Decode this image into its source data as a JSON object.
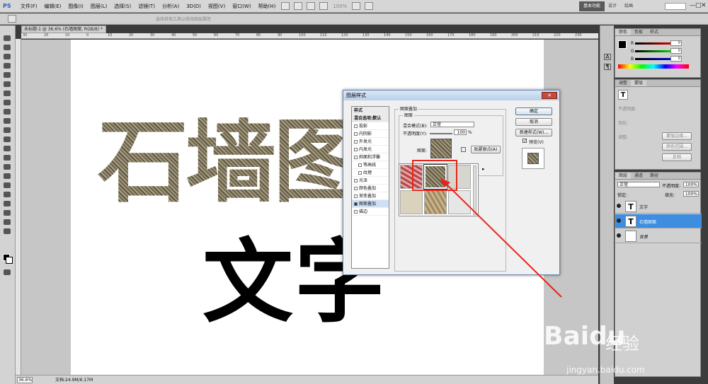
{
  "app": {
    "logo": "PS",
    "menus": [
      "文件(F)",
      "编辑(E)",
      "图像(I)",
      "图层(L)",
      "选择(S)",
      "滤镜(T)",
      "分析(A)",
      "3D(D)",
      "视图(V)",
      "窗口(W)",
      "帮助(H)"
    ],
    "zoom_readout": "100%",
    "workspaces": {
      "active": "基本功能",
      "design": "设计",
      "painting": "绘画"
    },
    "window_controls": [
      "—",
      "□",
      "✕"
    ]
  },
  "options_bar": {
    "hint": "选择其他工具以修改图层属性"
  },
  "document": {
    "tab_title": "未标题-1 @ 36.6% (石墙图案, RGB/8) *",
    "ruler_ticks": [
      "30",
      "20",
      "10",
      "0",
      "10",
      "20",
      "30",
      "40",
      "50",
      "60",
      "70",
      "80",
      "90",
      "100",
      "110",
      "120",
      "130",
      "140",
      "150",
      "160",
      "170",
      "180",
      "190",
      "200",
      "210",
      "220",
      "230"
    ],
    "stone_text": "石墙图",
    "black_text": "文字"
  },
  "status": {
    "zoom": "36.6%",
    "doc_info": "文档:24.9M/6.17M"
  },
  "color_panel": {
    "tabs": [
      "颜色",
      "色板",
      "样式"
    ],
    "channels": [
      {
        "label": "R",
        "value": "0"
      },
      {
        "label": "G",
        "value": "0"
      },
      {
        "label": "B",
        "value": "0"
      }
    ]
  },
  "adjust_panel": {
    "tabs": [
      "调整",
      "蒙版"
    ],
    "items": [
      "不透明度:",
      "羽化:",
      "调整:"
    ],
    "buttons": [
      "蒙版边缘...",
      "颜色范围...",
      "反相"
    ]
  },
  "layers_panel": {
    "tabs": [
      "图层",
      "通道",
      "路径"
    ],
    "blend_mode": "正常",
    "opacity_label": "不透明度:",
    "opacity": "100%",
    "lock_label": "锁定:",
    "fill_label": "填充:",
    "fill": "100%",
    "layers": [
      {
        "name": "文字",
        "thumb": "T",
        "selected": false
      },
      {
        "name": "石墙图案",
        "thumb": "T",
        "selected": true
      },
      {
        "name": "背景",
        "thumb": "",
        "selected": false
      }
    ]
  },
  "dialog": {
    "title": "图层样式",
    "close": "✕",
    "styles": [
      {
        "label": "样式",
        "head": true,
        "checkbox": false,
        "checked": false,
        "indent": false
      },
      {
        "label": "混合选项:默认",
        "head": true,
        "checkbox": false,
        "checked": false,
        "indent": false
      },
      {
        "label": "投影",
        "head": false,
        "checkbox": true,
        "checked": false,
        "indent": false
      },
      {
        "label": "内阴影",
        "head": false,
        "checkbox": true,
        "checked": false,
        "indent": false
      },
      {
        "label": "外发光",
        "head": false,
        "checkbox": true,
        "checked": false,
        "indent": false
      },
      {
        "label": "内发光",
        "head": false,
        "checkbox": true,
        "checked": false,
        "indent": false
      },
      {
        "label": "斜面和浮雕",
        "head": false,
        "checkbox": true,
        "checked": false,
        "indent": false
      },
      {
        "label": "等高线",
        "head": false,
        "checkbox": true,
        "checked": false,
        "indent": true
      },
      {
        "label": "纹理",
        "head": false,
        "checkbox": true,
        "checked": false,
        "indent": true
      },
      {
        "label": "光泽",
        "head": false,
        "checkbox": true,
        "checked": false,
        "indent": false
      },
      {
        "label": "颜色叠加",
        "head": false,
        "checkbox": true,
        "checked": false,
        "indent": false
      },
      {
        "label": "渐变叠加",
        "head": false,
        "checkbox": true,
        "checked": false,
        "indent": false
      },
      {
        "label": "图案叠加",
        "head": false,
        "checkbox": true,
        "checked": true,
        "indent": false
      },
      {
        "label": "描边",
        "head": false,
        "checkbox": true,
        "checked": false,
        "indent": false
      }
    ],
    "section_title": "图案叠加",
    "group_title": "图案",
    "blend_label": "混合模式(B):",
    "blend_value": "正常",
    "opacity_label": "不透明度(Y):",
    "opacity_value": "100",
    "opacity_unit": "%",
    "pattern_label": "图案:",
    "snap_button": "贴紧原点(A)",
    "buttons": {
      "ok": "确定",
      "cancel": "取消",
      "new_style": "新建样式(W)...",
      "preview": "预览(V)"
    },
    "preview_checked": true
  },
  "watermark": {
    "brand": "Baidu",
    "sub": "经验",
    "url": "jingyan.baidu.com"
  },
  "colors": {
    "highlight": "#e8241a",
    "selection": "#3d8ee0",
    "dialog_border": "#6a8ab4"
  }
}
